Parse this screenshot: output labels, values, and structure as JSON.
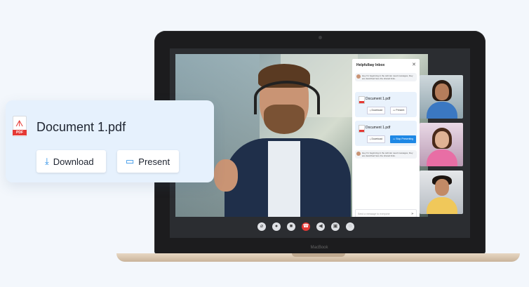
{
  "laptop": {
    "brand": "MacBook"
  },
  "chat": {
    "title": "Helpfulbay Inbox",
    "close_icon": "close-icon",
    "messages": [
      "Hey I'm beginning in the call can need messages, they are described here the shared links.",
      "Hey I'm beginning in the call can need messages, they are described here the shared links."
    ],
    "documents": [
      {
        "name": "Document 1.pdf",
        "actions": [
          "Download",
          "Present"
        ]
      },
      {
        "name": "Document 1.pdf",
        "actions": [
          "Download",
          "Stop Presenting"
        ]
      }
    ],
    "input_placeholder": "Send a message to everyone"
  },
  "toolbar": {
    "icons": [
      "attach-icon",
      "mic-icon",
      "camera-icon",
      "end-call-icon",
      "speaker-icon",
      "screen-share-icon",
      "chat-icon"
    ]
  },
  "card": {
    "file_badge": "PDF",
    "file_name": "Document 1.pdf",
    "download_label": "Download",
    "present_label": "Present"
  },
  "colors": {
    "accent": "#1e88e5",
    "danger": "#e53935",
    "card_bg": "#e6f1fd"
  }
}
